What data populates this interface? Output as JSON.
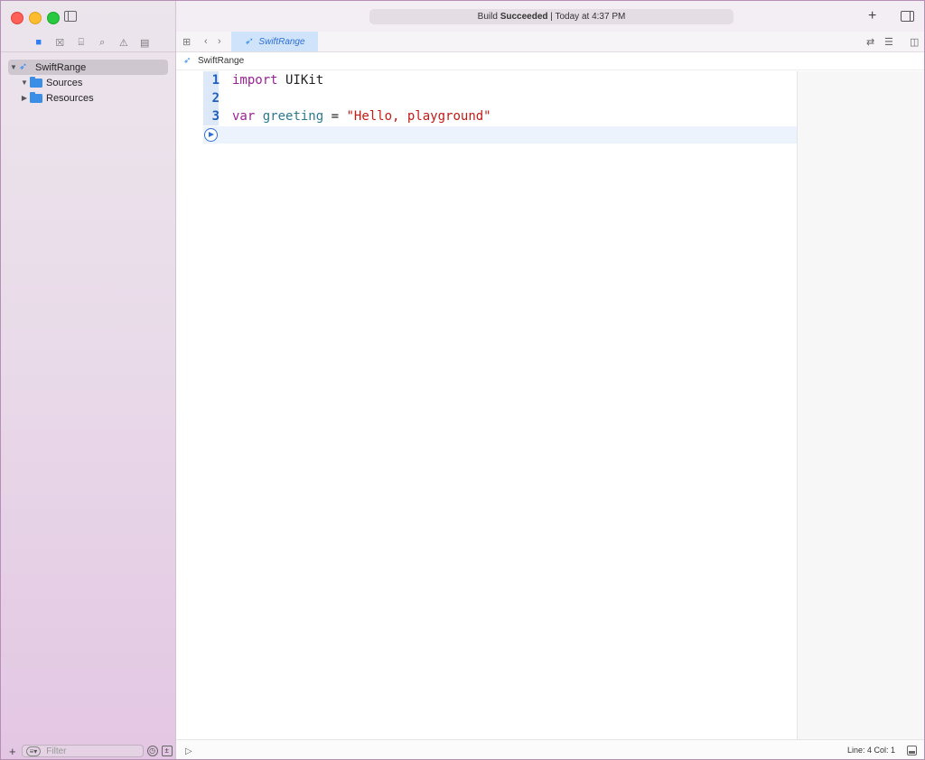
{
  "window": {
    "status_prefix": "Build",
    "status_bold": "Succeeded",
    "status_suffix": "| Today at 4:37 PM"
  },
  "navigator": {
    "icons": [
      "folder-icon",
      "source-control-icon",
      "symbol-icon",
      "search-icon",
      "issue-icon",
      "report-icon"
    ],
    "tree": [
      {
        "label": "SwiftRange",
        "type": "swift-project",
        "expanded": true,
        "selected": true
      },
      {
        "label": "Sources",
        "type": "folder",
        "expanded": true
      },
      {
        "label": "Resources",
        "type": "folder",
        "expanded": false
      }
    ],
    "filter_placeholder": "Filter"
  },
  "tabs": [
    {
      "label": "SwiftRange",
      "active": true
    }
  ],
  "breadcrumb": {
    "label": "SwiftRange"
  },
  "editor": {
    "lines": [
      {
        "number": "1",
        "tokens": [
          {
            "t": "import",
            "k": "kw"
          },
          {
            "t": " UIKit",
            "k": "plain"
          }
        ]
      },
      {
        "number": "2",
        "tokens": []
      },
      {
        "number": "3",
        "tokens": [
          {
            "t": "var",
            "k": "kw"
          },
          {
            "t": " ",
            "k": "plain"
          },
          {
            "t": "greeting",
            "k": "id"
          },
          {
            "t": " = ",
            "k": "plain"
          },
          {
            "t": "\"Hello, playground\"",
            "k": "str"
          }
        ]
      }
    ]
  },
  "statusbar": {
    "line_col": "Line: 4  Col: 1"
  },
  "colors": {
    "accent": "#2e7cf6",
    "keyword": "#9b2393",
    "identifier": "#2c7990",
    "string": "#c41a16"
  }
}
